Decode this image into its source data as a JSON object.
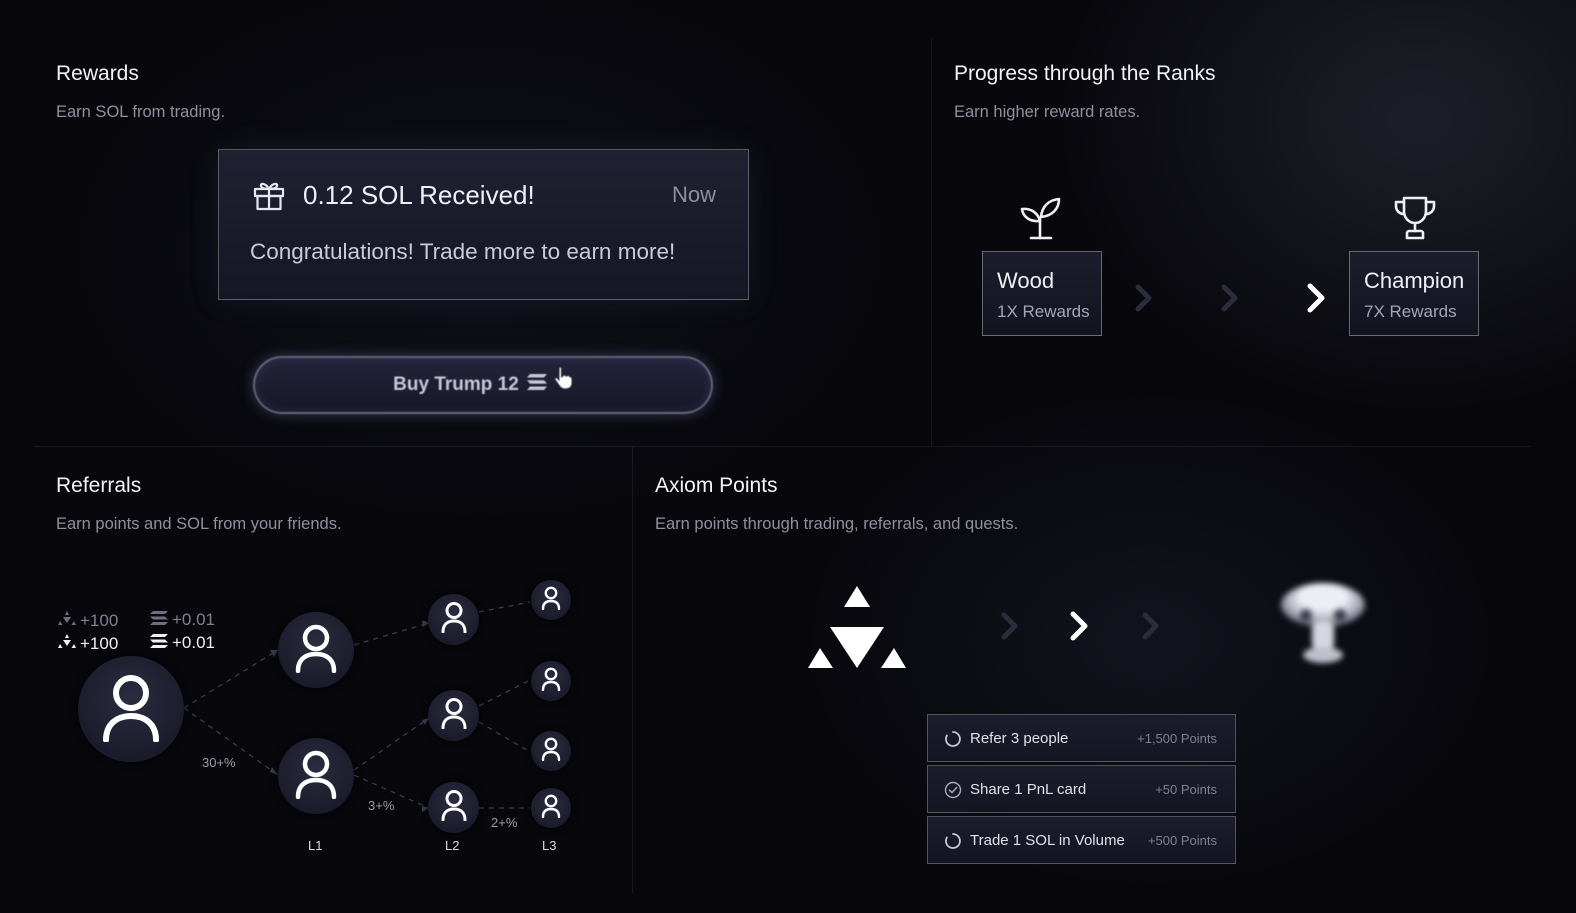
{
  "rewards": {
    "title": "Rewards",
    "subtitle": "Earn SOL from trading.",
    "notification": {
      "icon": "gift-icon",
      "title": "0.12 SOL Received!",
      "time": "Now",
      "message": "Congratulations! Trade more to earn more!"
    },
    "buy_button": {
      "label": "Buy Trump 12",
      "icon": "solana-icon"
    }
  },
  "ranks": {
    "title": "Progress through the Ranks",
    "subtitle": "Earn higher reward rates.",
    "start": {
      "icon": "sprout-icon",
      "name": "Wood",
      "rewards": "1X Rewards"
    },
    "end": {
      "icon": "trophy-icon",
      "name": "Champion",
      "rewards": "7X Rewards"
    }
  },
  "referrals": {
    "title": "Referrals",
    "subtitle": "Earn points and SOL from your friends.",
    "stats": [
      {
        "icon": "axiom-points-icon",
        "value": "+100",
        "dim": true
      },
      {
        "icon": "solana-icon",
        "value": "+0.01",
        "dim": true
      },
      {
        "icon": "axiom-points-icon",
        "value": "+100",
        "dim": false
      },
      {
        "icon": "solana-icon",
        "value": "+0.01",
        "dim": false
      }
    ],
    "percents": {
      "l1": "30+%",
      "l2": "3+%",
      "l3": "2+%"
    },
    "levels": [
      "L1",
      "L2",
      "L3"
    ]
  },
  "points": {
    "title": "Axiom Points",
    "subtitle": "Earn points through trading, referrals, and quests.",
    "quests": [
      {
        "label": "Refer 3 people",
        "points": "+1,500 Points",
        "status": "in-progress"
      },
      {
        "label": "Share 1 PnL card",
        "points": "+50 Points",
        "status": "completed"
      },
      {
        "label": "Trade 1 SOL in Volume",
        "points": "+500 Points",
        "status": "in-progress"
      }
    ]
  },
  "colors": {
    "background": "#07070c",
    "text": "#eceef4",
    "muted": "#8e90a0",
    "card": "#1c1d2c"
  }
}
